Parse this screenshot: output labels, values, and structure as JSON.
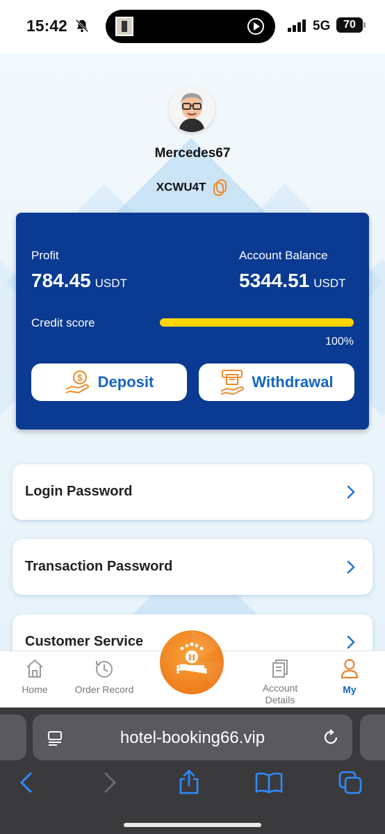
{
  "status_bar": {
    "time": "15:42",
    "network": "5G",
    "battery": "70"
  },
  "profile": {
    "username": "Mercedes67",
    "invite_code": "XCWU4T"
  },
  "card": {
    "profit_label": "Profit",
    "profit_value": "784.45",
    "profit_unit": "USDT",
    "balance_label": "Account Balance",
    "balance_value": "5344.51",
    "balance_unit": "USDT",
    "credit_label": "Credit score",
    "credit_percent_text": "100%",
    "credit_fraction": 1.0,
    "deposit_label": "Deposit",
    "withdrawal_label": "Withdrawal"
  },
  "menu": {
    "items": [
      {
        "label": "Login Password"
      },
      {
        "label": "Transaction Password"
      },
      {
        "label": "Customer Service"
      }
    ]
  },
  "bottom_nav": {
    "home": "Home",
    "order_record": "Order Record",
    "account_details": "Account Details",
    "my": "My",
    "active_color": "#e8802a",
    "inactive_color": "#777777"
  },
  "browser": {
    "url": "hotel-booking66.vip"
  },
  "colors": {
    "card_bg": "#0a3a92",
    "accent_blue": "#1565c0",
    "credit_bar": "#ffd400",
    "brand_orange": "#ef7d1d"
  }
}
